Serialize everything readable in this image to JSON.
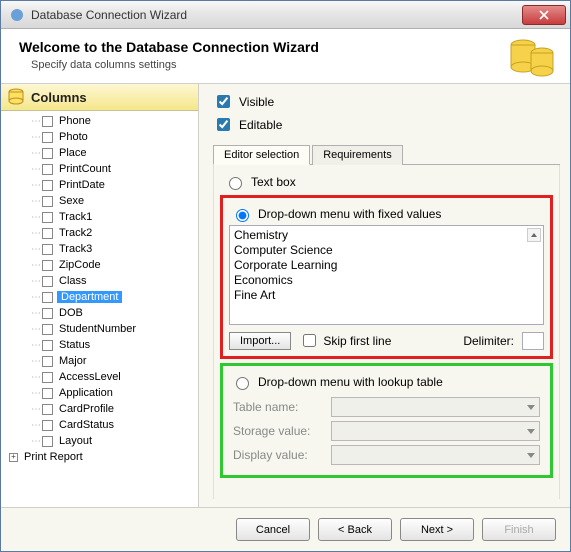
{
  "window": {
    "title": "Database Connection Wizard"
  },
  "header": {
    "heading": "Welcome to the Database Connection Wizard",
    "subtitle": "Specify data columns settings"
  },
  "sidebar": {
    "title": "Columns",
    "root": "Print Report",
    "items": [
      "Phone",
      "Photo",
      "Place",
      "PrintCount",
      "PrintDate",
      "Sexe",
      "Track1",
      "Track2",
      "Track3",
      "ZipCode",
      "Class",
      "Department",
      "DOB",
      "StudentNumber",
      "Status",
      "Major",
      "AccessLevel",
      "Application",
      "CardProfile",
      "CardStatus",
      "Layout"
    ],
    "selected_index": 11
  },
  "options": {
    "visible": "Visible",
    "editable": "Editable"
  },
  "tabs": {
    "editor": "Editor selection",
    "requirements": "Requirements"
  },
  "editor": {
    "textbox": "Text box",
    "fixed": "Drop-down menu with fixed values",
    "lookup": "Drop-down menu with lookup table",
    "values": [
      "Chemistry",
      "Computer Science",
      "Corporate Learning",
      "Economics",
      "Fine Art"
    ],
    "import_btn": "Import...",
    "skip": "Skip first line",
    "delimiter_label": "Delimiter:",
    "table_name": "Table name:",
    "storage_value": "Storage value:",
    "display_value": "Display value:"
  },
  "footer": {
    "cancel": "Cancel",
    "back": "< Back",
    "next": "Next >",
    "finish": "Finish"
  }
}
